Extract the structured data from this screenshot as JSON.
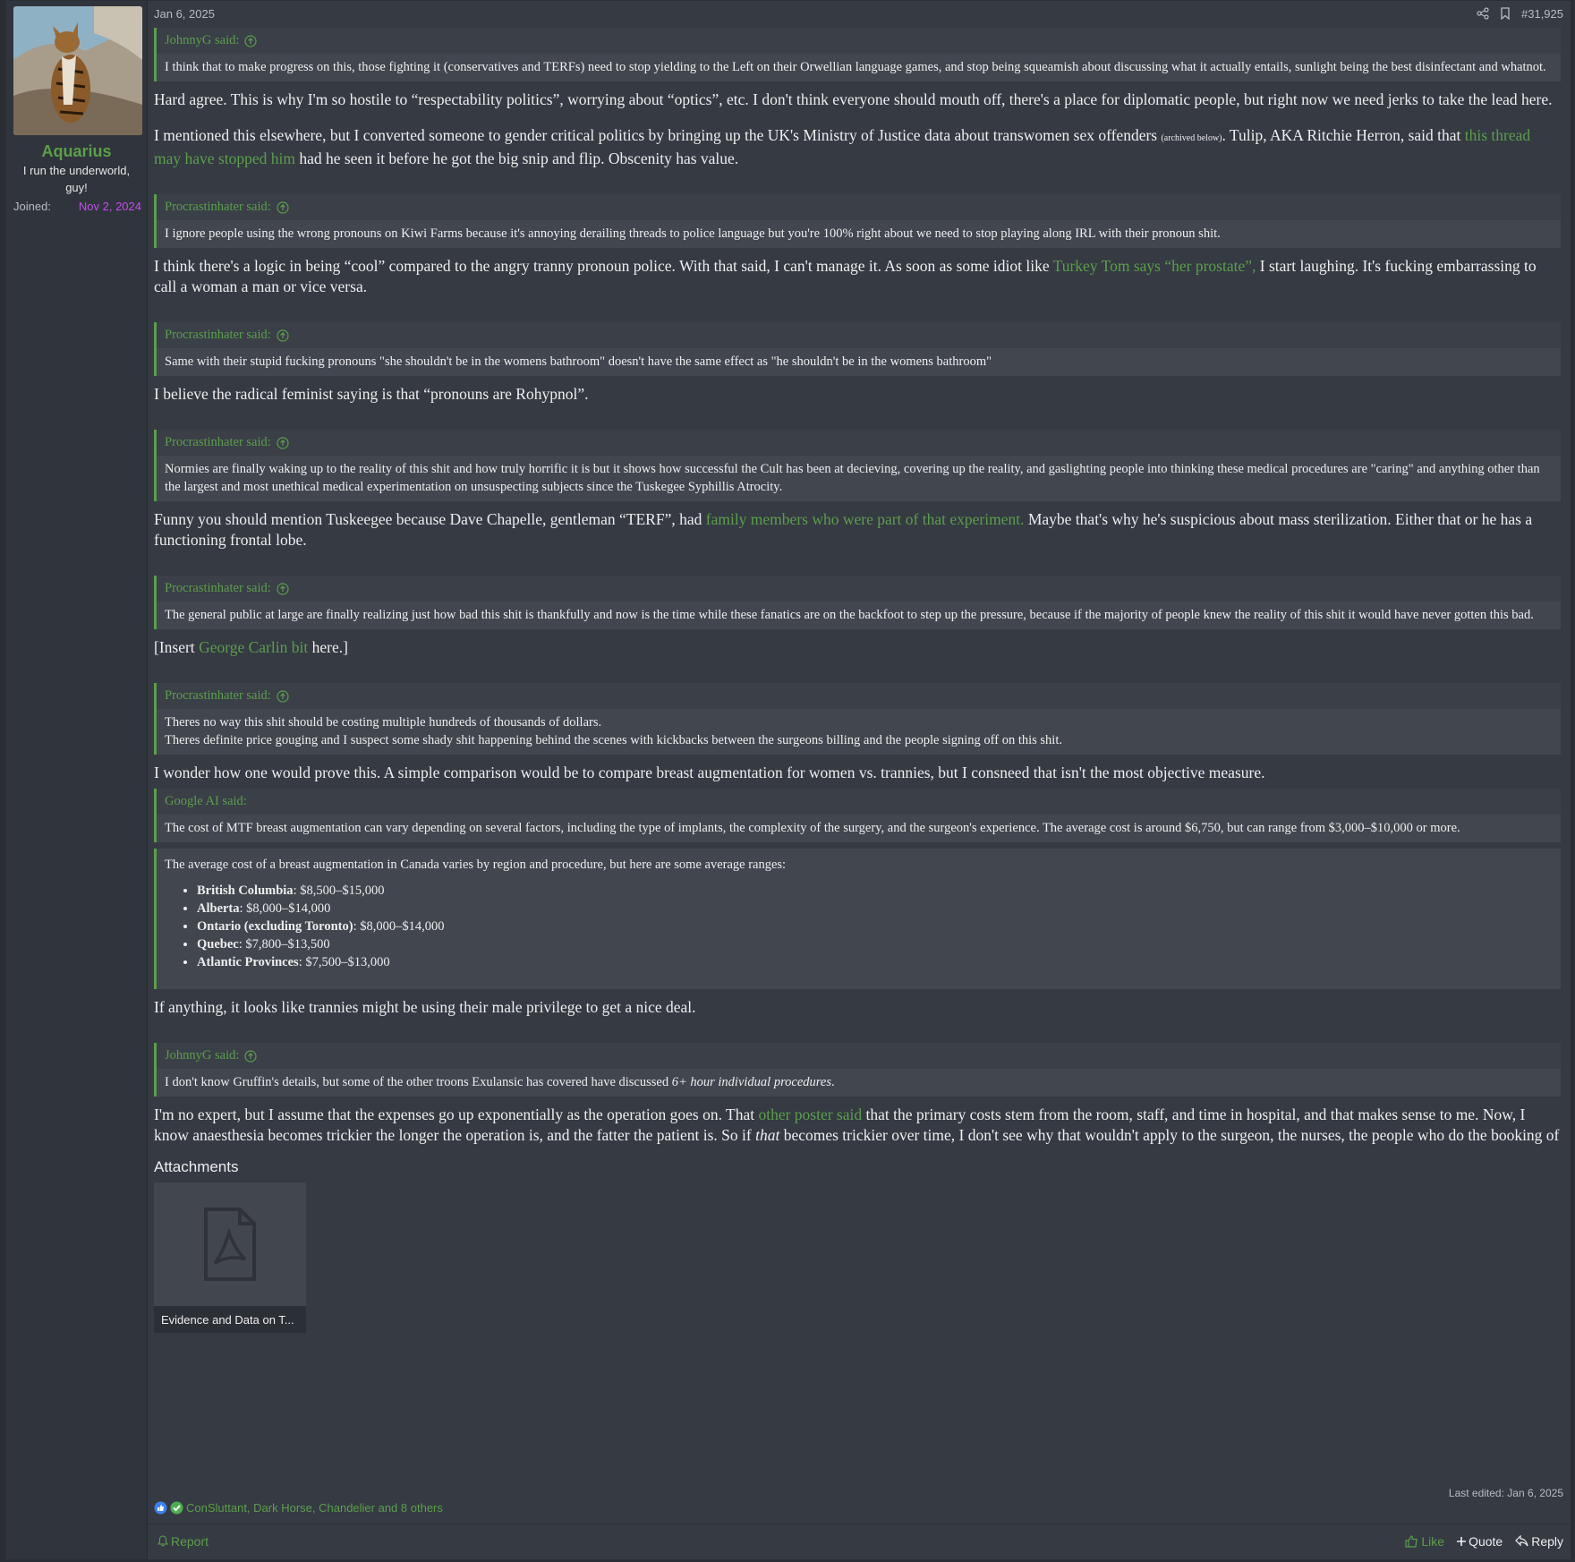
{
  "user": {
    "name": "Aquarius",
    "title": "I run the underworld, guy!",
    "joined_label": "Joined:",
    "joined_date": "Nov 2, 2024"
  },
  "header": {
    "date": "Jan 6, 2025",
    "post_number": "#31,925"
  },
  "blocks": [
    {
      "quote_author": "JohnnyG said:",
      "quote_text": "I think that to make progress on this, those fighting it (conservatives and TERFs) need to stop yielding to the Left on their Orwellian language games, and stop being squeamish about discussing what it actually entails, sunlight being the best disinfectant and whatnot."
    },
    {
      "text": "Hard agree. This is why I'm so hostile to “respectability politics”, worrying about “optics”, etc. I don't think everyone should mouth off, there's a place for diplomatic people, but right now we need jerks to take the lead here."
    },
    {
      "text_a": "I mentioned this elsewhere, but I converted someone to gender critical politics by bringing up the UK's Ministry of Justice data about transwomen sex offenders ",
      "small": "(archived below)",
      "text_b": ". Tulip, AKA Ritchie Herron, said that ",
      "link": "this thread may have stopped him",
      "text_c": " had he seen it before he got the big snip and flip. Obscenity has value."
    },
    {
      "quote_author": "Procrastinhater said:",
      "quote_text": "I ignore people using the wrong pronouns on Kiwi Farms because it's annoying derailing threads to police language but you're 100% right about we need to stop playing along IRL with their pronoun shit."
    },
    {
      "text_a": "I think there's a logic in being “cool” compared to the angry tranny pronoun police. With that said, I can't manage it. As soon as some idiot like ",
      "link": "Turkey Tom says “her prostate”,",
      "text_b": " I start laughing. It's fucking embarrassing to call a woman a man or vice versa."
    },
    {
      "quote_author": "Procrastinhater said:",
      "quote_text": "Same with their stupid fucking pronouns \"she shouldn't be in the womens bathroom\" doesn't have the same effect as \"he shouldn't be in the womens bathroom\""
    },
    {
      "text": "I believe the radical feminist saying is that “pronouns are Rohypnol”."
    },
    {
      "quote_author": "Procrastinhater said:",
      "quote_text": "Normies are finally waking up to the reality of this shit and how truly horrific it is but it shows how successful the Cult has been at decieving, covering up the reality, and gaslighting people into thinking these medical procedures are \"caring\" and anything other than the largest and most unethical medical experimentation on unsuspecting subjects since the Tuskegee Syphillis Atrocity."
    },
    {
      "text_a": "Funny you should mention Tuskeegee because Dave Chapelle, gentleman “TERF”, had ",
      "link": "family members who were part of that experiment.",
      "text_b": " Maybe that's why he's suspicious about mass sterilization. Either that or he has a functioning frontal lobe."
    },
    {
      "quote_author": "Procrastinhater said:",
      "quote_text": "The general public at large are finally realizing just how bad this shit is thankfully and now is the time while these fanatics are on the backfoot to step up the pressure, because if the majority of people knew the reality of this shit it would have never gotten this bad."
    },
    {
      "text_a": "[Insert ",
      "link": "George Carlin bit",
      "text_b": " here.]"
    },
    {
      "quote_author": "Procrastinhater said:",
      "quote_line1": "Theres no way this shit should be costing multiple hundreds of thousands of dollars.",
      "quote_line2": "Theres definite price gouging and I suspect some shady shit happening behind the scenes with kickbacks between the surgeons billing and the people signing off on this shit."
    },
    {
      "text": "I wonder how one would prove this. A simple comparison would be to compare breast augmentation for women vs. trannies, but I consneed that isn't the most objective measure."
    },
    {
      "quote_author": "Google AI said:",
      "quote_text": "The cost of MTF breast augmentation can vary depending on several factors, including the type of implants, the complexity of the surgery, and the surgeon's experience. The average cost is around $6,750, but can range from $3,000–$10,000 or more."
    },
    {
      "quote_intro": "The average cost of a breast augmentation in Canada varies by region and procedure, but here are some average ranges:",
      "items": [
        {
          "region": "British Columbia",
          "range": ": $8,500–$15,000"
        },
        {
          "region": "Alberta",
          "range": ": $8,000–$14,000"
        },
        {
          "region": "Ontario (excluding Toronto)",
          "range": ": $8,000–$14,000"
        },
        {
          "region": "Quebec",
          "range": ": $7,800–$13,500"
        },
        {
          "region": "Atlantic Provinces",
          "range": ": $7,500–$13,000"
        }
      ]
    },
    {
      "text": "If anything, it looks like trannies might be using their male privilege to get a nice deal."
    },
    {
      "quote_author": "JohnnyG said:",
      "quote_text": "I don't know Gruffin's details, but some of the other troons Exulansic has covered have discussed ",
      "quote_em": "6+ hour individual procedures",
      "quote_end": "."
    },
    {
      "text_a": "I'm no expert, but I assume that the expenses go up exponentially as the operation goes on. That ",
      "link": "other poster said",
      "text_b": " that the primary costs stem from the room, staff, and time in hospital, and that makes sense to me. Now, I know anaesthesia becomes trickier the longer the operation is, and the fatter the patient is. So if ",
      "em": "that",
      "text_c": " becomes trickier over time, I don't see why that wouldn't apply to the surgeon, the nurses, the people who do the booking of"
    }
  ],
  "attachments": {
    "title": "Attachments",
    "file_name": "Evidence and Data on T..."
  },
  "last_edited": "Last edited: Jan 6, 2025",
  "reactions": {
    "users": "ConSluttant, Dark Horse, Chandelier and 8 others"
  },
  "footer": {
    "report": "Report",
    "like": "Like",
    "quote": "Quote",
    "reply": "Reply"
  },
  "colors": {
    "accent": "#5c9e4a",
    "joined_date": "#c34ef0",
    "background": "#353a43"
  },
  "icons": [
    "share-icon",
    "bookmark-icon",
    "quote-up-arrow-icon",
    "pdf-file-icon",
    "like-reaction-icon",
    "check-reaction-icon",
    "bell-icon",
    "thumbs-up-icon",
    "plus-icon",
    "reply-arrow-icon"
  ]
}
